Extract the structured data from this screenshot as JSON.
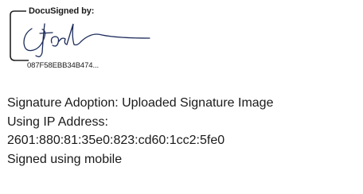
{
  "signature_stamp": {
    "header_label": "DocuSigned by:",
    "envelope_id": "087F58EBB34B474...",
    "signature_name": "signature image"
  },
  "details": {
    "adoption": "Signature Adoption: Uploaded Signature Image",
    "ip_label": "Using IP Address:",
    "ip_address": "2601:880:81:35e0:823:cd60:1cc2:5fe0",
    "method": "Signed using mobile"
  }
}
